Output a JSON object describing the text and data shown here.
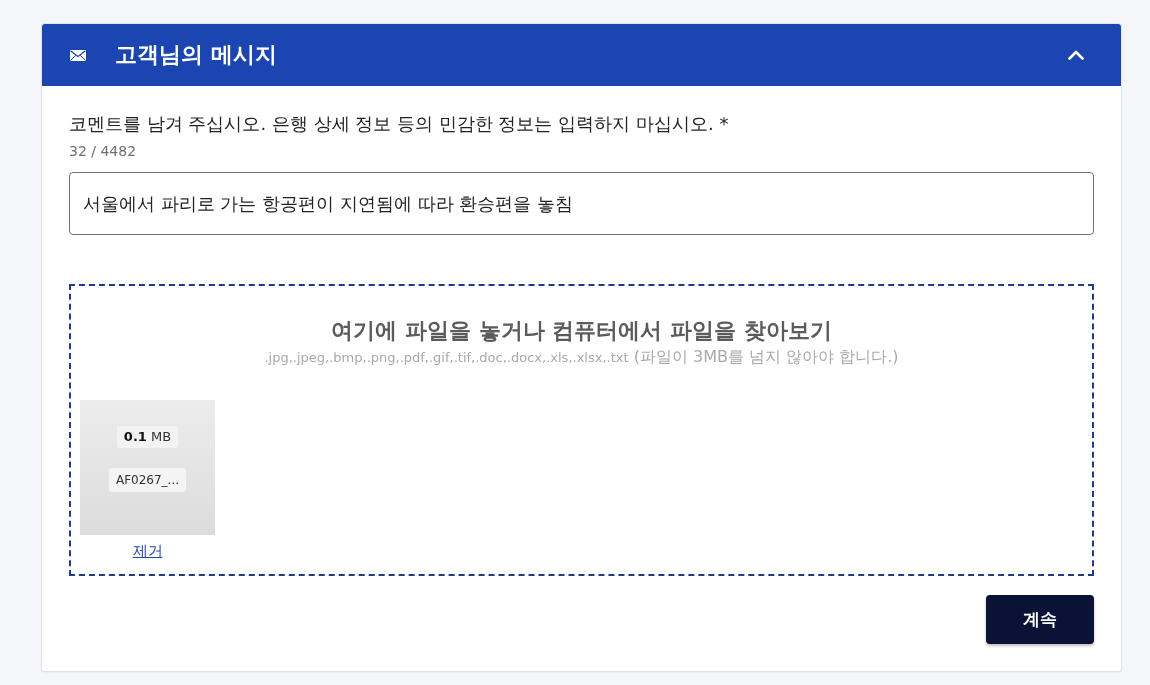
{
  "panel": {
    "title": "고객님의 메시지",
    "expanded": true
  },
  "comment": {
    "label": "코멘트를 남겨 주십시오. 은행 상세 정보 등의 민감한 정보는 입력하지 마십시오. *",
    "counter": "32 / 4482",
    "value": "서울에서 파리로 가는 항공편이 지연됨에 따라 환승편을 놓침"
  },
  "dropzone": {
    "title": "여기에 파일을 놓거나 컴퓨터에서 파일을 찾아보기",
    "formats": ".jpg,.jpeg,.bmp,.png,.pdf,.gif,.tif,.doc,.docx,.xls,.xlsx,.txt",
    "size_limit": "(파일이 3MB를 넘지 않아야 합니다.)",
    "files": [
      {
        "size": "**0.1** MB",
        "name": "AF0267_...",
        "remove": "제거"
      }
    ]
  },
  "buttons": [
    {
      "label": "계속"
    }
  ]
}
